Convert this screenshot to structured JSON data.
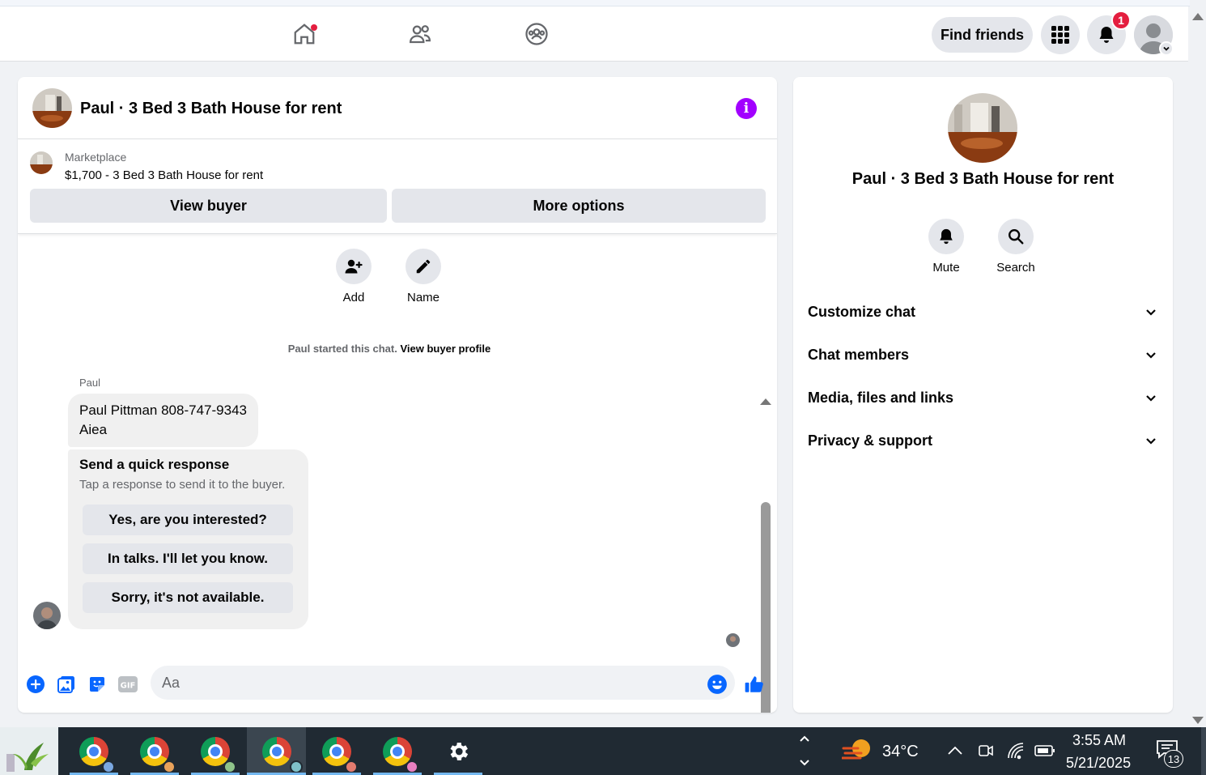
{
  "nav": {
    "find_friends_label": "Find friends",
    "notification_count": "1"
  },
  "chat": {
    "title": "Paul · 3 Bed 3 Bath House for rent",
    "listing_source": "Marketplace",
    "listing_title": "$1,700 - 3 Bed 3 Bath House for rent",
    "view_buyer_label": "View buyer",
    "more_options_label": "More options",
    "actions": [
      {
        "label": "Add"
      },
      {
        "label": "Name"
      }
    ],
    "started_text": "Paul started this chat.",
    "started_link": "View buyer profile",
    "sender_name": "Paul",
    "message_line1": "Paul Pittman 808-747-9343",
    "message_line2": "Aiea",
    "quick_title": "Send a quick response",
    "quick_subtitle": "Tap a response to send it to the buyer.",
    "quick_responses": [
      "Yes, are you interested?",
      "In talks. I'll let you know.",
      "Sorry, it's not available."
    ],
    "composer_placeholder": "Aa"
  },
  "side": {
    "title": "Paul · 3 Bed 3 Bath House for rent",
    "mute_label": "Mute",
    "search_label": "Search",
    "sections": [
      "Customize chat",
      "Chat members",
      "Media, files and links",
      "Privacy & support"
    ]
  },
  "taskbar": {
    "temperature": "34°C",
    "time": "3:55 AM",
    "date": "5/21/2025",
    "notification_count": "13"
  },
  "colors": {
    "accent_blue": "#0866ff",
    "info_purple": "#a200ff",
    "badge_red": "#e41e3f"
  }
}
